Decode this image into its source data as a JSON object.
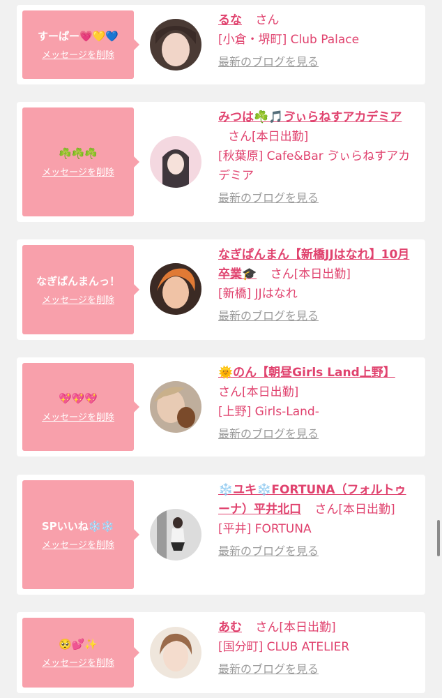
{
  "cards": [
    {
      "message": "すーぱー💗💛💙",
      "delete_label": "メッセージを削除",
      "name": "るな",
      "san": "さん",
      "status": "",
      "shop": "[小倉・堺町] Club Palace",
      "blog": "最新のブログを見る"
    },
    {
      "message": "☘️☘️☘️",
      "delete_label": "メッセージを削除",
      "name": "みつは☘️🎵ゔぃらねすアカデミア",
      "san": "さん",
      "status": "[本日出勤]",
      "shop": "[秋葉原] Cafe&Bar ゔぃらねすアカデミア",
      "blog": "最新のブログを見る"
    },
    {
      "message": "なぎぱんまんっ！",
      "delete_label": "メッセージを削除",
      "name": "なぎぱんまん【新橋JJはなれ】10月卒業🎓",
      "san": "さん",
      "status": "[本日出勤]",
      "shop": "[新橋] JJはなれ",
      "blog": "最新のブログを見る"
    },
    {
      "message": "💖💖💖",
      "delete_label": "メッセージを削除",
      "name": "🌞のん【朝昼Girls Land上野】",
      "san": "さん",
      "status": "[本日出勤]",
      "shop": "[上野] Girls-Land-",
      "blog": "最新のブログを見る"
    },
    {
      "message": "SPいいね❄️❄️",
      "delete_label": "メッセージを削除",
      "name": "❄️ユキ❄️FORTUNA（フォルトゥーナ）平井北口",
      "san": "さん",
      "status": "[本日出勤]",
      "shop": "[平井] FORTUNA",
      "blog": "最新のブログを見る"
    },
    {
      "message": "🥺💕✨",
      "delete_label": "メッセージを削除",
      "name": "あむ",
      "san": "さん",
      "status": "[本日出勤]",
      "shop": "[国分町] CLUB ATELIER",
      "blog": "最新のブログを見る"
    }
  ],
  "colors": {
    "accent": "#e0426e",
    "bubble": "#f8a0ab",
    "background": "#f1f1f1",
    "muted": "#9a9a9a"
  }
}
